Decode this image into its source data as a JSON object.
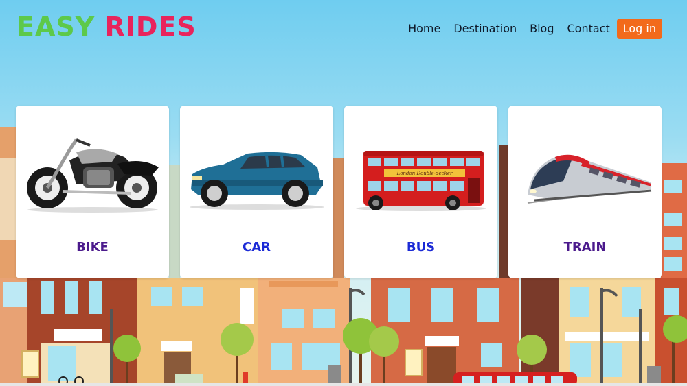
{
  "header": {
    "logo_word1": "EASY",
    "logo_word2": "RIDES",
    "nav": [
      "Home",
      "Destination",
      "Blog",
      "Contact"
    ],
    "login_label": "Log in"
  },
  "cards": [
    {
      "label": "BIKE",
      "icon": "motorcycle-icon"
    },
    {
      "label": "CAR",
      "icon": "car-icon"
    },
    {
      "label": "BUS",
      "icon": "double-decker-bus-icon"
    },
    {
      "label": "TRAIN",
      "icon": "bullet-train-icon"
    }
  ],
  "bus_sign": "London Double-decker",
  "colors": {
    "logo_green": "#5dc94a",
    "logo_red": "#e8245c",
    "login_orange": "#f26a1b",
    "label_purple": "#4b1a8c",
    "label_blue": "#1b2ad6"
  }
}
